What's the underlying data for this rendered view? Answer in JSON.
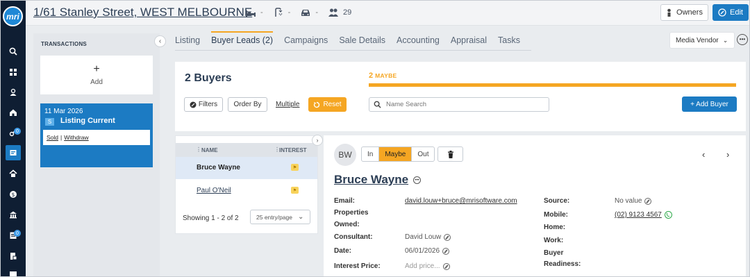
{
  "header": {
    "address": "1/61 Stanley Street, WEST MELBOURNE",
    "beds": "-",
    "baths": "-",
    "cars": "-",
    "contacts_count": "29",
    "owners_label": "Owners",
    "edit_label": "Edit"
  },
  "rail": {
    "logo": "mri",
    "badges": [
      "0",
      "0"
    ]
  },
  "transactions": {
    "title": "TRANSACTIONS",
    "add_label": "Add",
    "card": {
      "date": "11 Mar 2026",
      "badge": "S",
      "status": "Listing Current",
      "link_sold": "Sold",
      "separator": "|",
      "link_withdraw": "Withdraw"
    }
  },
  "tabs": [
    "Listing",
    "Buyer Leads (2)",
    "Campaigns",
    "Sale Details",
    "Accounting",
    "Appraisal",
    "Tasks"
  ],
  "vendor_select": "Media Vendor",
  "buyers": {
    "title": "2 Buyers",
    "maybe_count": "2",
    "maybe_label": "MAYBE",
    "filters_label": "Filters",
    "order_by_label": "Order By",
    "multiple_label": "Multiple",
    "reset_label": "Reset",
    "search_placeholder": "Name Search",
    "add_buyer_label": "+ Add Buyer"
  },
  "list": {
    "col_name": "NAME",
    "col_interest": "INTEREST",
    "rows": [
      {
        "name": "Bruce Wayne"
      },
      {
        "name": "Paul O'Neil"
      }
    ],
    "showing": "Showing 1 - 2 of 2",
    "per_page": "25 entry/page"
  },
  "detail": {
    "initials": "BW",
    "seg_in": "In",
    "seg_maybe": "Maybe",
    "seg_out": "Out",
    "name": "Bruce Wayne",
    "email_label": "Email:",
    "email": "david.louw+bruce@mrisoftware.com",
    "properties_label_1": "Properties",
    "properties_label_2": "Owned:",
    "consultant_label": "Consultant:",
    "consultant": "David Louw",
    "date_label": "Date:",
    "date": "06/01/2026",
    "interest_label": "Interest Price:",
    "interest_placeholder": "Add price...",
    "source_label": "Source:",
    "source": "No value",
    "mobile_label": "Mobile:",
    "mobile": "(02) 9123 4567",
    "home_label": "Home:",
    "work_label": "Work:",
    "readiness_label_1": "Buyer",
    "readiness_label_2": "Readiness:"
  },
  "colors": {
    "rail": "#0f1e33",
    "primary": "#1c7bc3",
    "accent": "#f5a623"
  }
}
